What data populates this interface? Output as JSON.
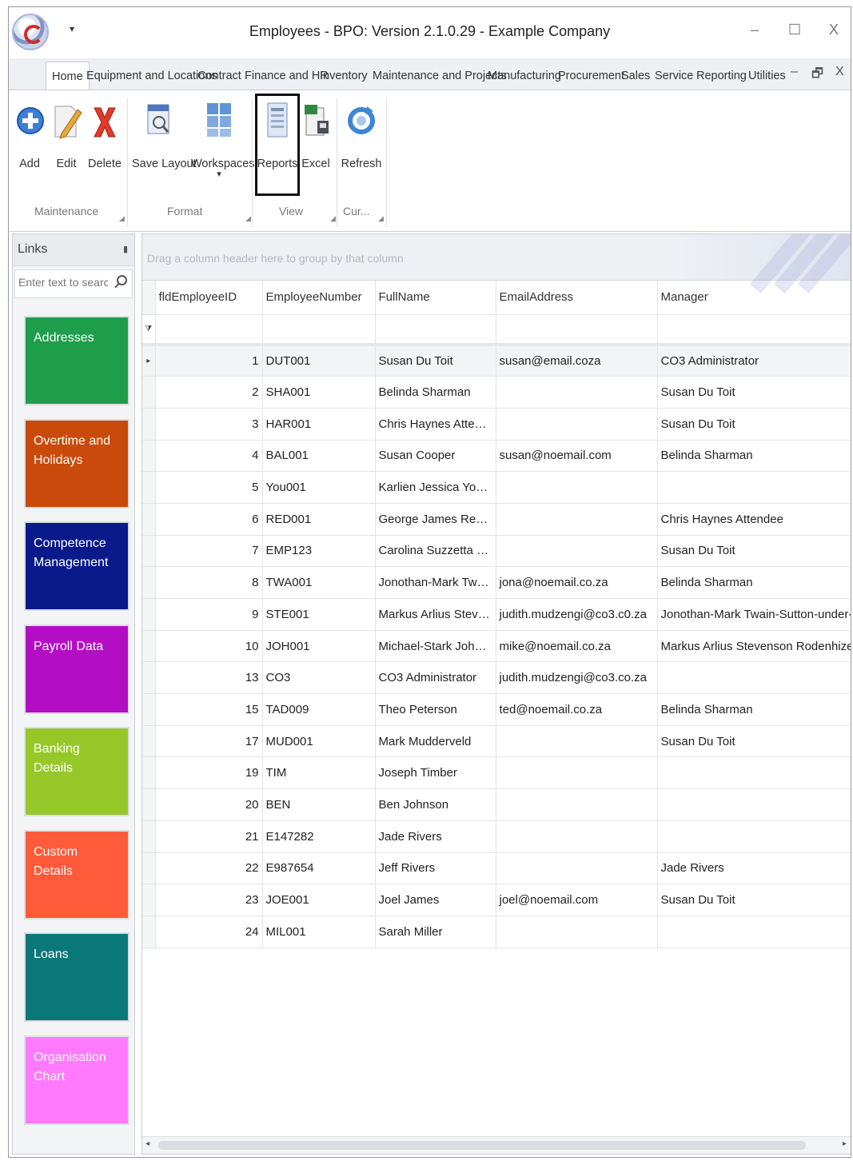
{
  "window": {
    "title": "Employees - BPO: Version 2.1.0.29 - Example Company",
    "qa_arrow": "▾",
    "minimize": "–",
    "maximize": "☐",
    "close": "X",
    "restore_small": "🗗",
    "close_small": "X",
    "collapse_small": "–"
  },
  "tabs": [
    "Home",
    "Equipment and Locations",
    "Contract",
    "Finance and HR",
    "Inventory",
    "Maintenance and Projects",
    "Manufacturing",
    "Procurement",
    "Sales",
    "Service",
    "Reporting",
    "Utilities"
  ],
  "ribbon": {
    "buttons": {
      "add": "Add",
      "edit": "Edit",
      "delete": "Delete",
      "save_layout": "Save Layout",
      "workspaces": "Workspaces",
      "workspaces_arrow": "▾",
      "reports": "Reports",
      "excel": "Excel",
      "refresh": "Refresh"
    },
    "groups": {
      "maintenance": "Maintenance",
      "format": "Format",
      "view": "View",
      "current": "Cur..."
    }
  },
  "links": {
    "title": "Links",
    "pin": "▮",
    "search_placeholder": "Enter text to search...",
    "tiles": [
      {
        "label": "Addresses",
        "color": "#1e9e4a"
      },
      {
        "label": "Overtime and Holidays",
        "color": "#c94a0a"
      },
      {
        "label": "Competence Management",
        "color": "#0a1a8a"
      },
      {
        "label": "Payroll Data",
        "color": "#b40ec4"
      },
      {
        "label": "Banking Details",
        "color": "#96c82a"
      },
      {
        "label": "Custom Details",
        "color": "#ff5a3a"
      },
      {
        "label": "Loans",
        "color": "#0a7878"
      },
      {
        "label": "Organisation Chart",
        "color": "#ff7aff"
      }
    ]
  },
  "grid": {
    "group_hint": "Drag a column header here to group by that column",
    "columns": [
      "fldEmployeeID",
      "EmployeeNumber",
      "FullName",
      "EmailAddress",
      "Manager"
    ],
    "filter_marker": "⧩",
    "focus_marker": "▸",
    "rows": [
      [
        "1",
        "DUT001",
        "Susan Du Toit",
        "susan@email.coza",
        "CO3 Administrator"
      ],
      [
        "2",
        "SHA001",
        "Belinda Sharman",
        "",
        "Susan Du Toit"
      ],
      [
        "3",
        "HAR001",
        "Chris Haynes Attendee",
        "",
        "Susan Du Toit"
      ],
      [
        "4",
        "BAL001",
        "Susan Cooper",
        "susan@noemail.com",
        "Belinda Sharman"
      ],
      [
        "5",
        "You001",
        "Karlien Jessica Young Dun...",
        "",
        ""
      ],
      [
        "6",
        "RED001",
        "George James Reddy Jef...",
        "",
        "Chris Haynes Attendee"
      ],
      [
        "7",
        "EMP123",
        "Carolina Suzzetta Lourens...",
        "",
        "Susan Du Toit"
      ],
      [
        "8",
        "TWA001",
        "Jonothan-Mark Twain-Sut...",
        "jona@noemail.co.za",
        "Belinda Sharman"
      ],
      [
        "9",
        "STE001",
        "Markus Arlius Stevenson ...",
        "judith.mudzengi@co3.c0.za",
        "Jonothan-Mark Twain-Sutton-under-Whitestonecliffe"
      ],
      [
        "10",
        "JOH001",
        "Michael-Stark Johnson St...",
        "mike@noemail.co.za",
        "Markus Arlius Stevenson Rodenhizer Tomljenovich"
      ],
      [
        "13",
        "CO3",
        "CO3 Administrator",
        "judith.mudzengi@co3.co.za",
        ""
      ],
      [
        "15",
        "TAD009",
        "Theo Peterson",
        "ted@noemail.co.za",
        "Belinda Sharman"
      ],
      [
        "17",
        "MUD001",
        "Mark Mudderveld",
        "",
        "Susan Du Toit"
      ],
      [
        "19",
        "TIM",
        "Joseph Timber",
        "",
        ""
      ],
      [
        "20",
        "BEN",
        "Ben Johnson",
        "",
        ""
      ],
      [
        "21",
        "E147282",
        "Jade Rivers",
        "",
        ""
      ],
      [
        "22",
        "E987654",
        "Jeff Rivers",
        "",
        "Jade Rivers"
      ],
      [
        "23",
        "JOE001",
        "Joel James",
        "joel@noemail.com",
        "Susan Du Toit"
      ],
      [
        "24",
        "MIL001",
        "Sarah Miller",
        "",
        ""
      ]
    ]
  },
  "scroll": {
    "left": "◂",
    "right": "▸"
  }
}
